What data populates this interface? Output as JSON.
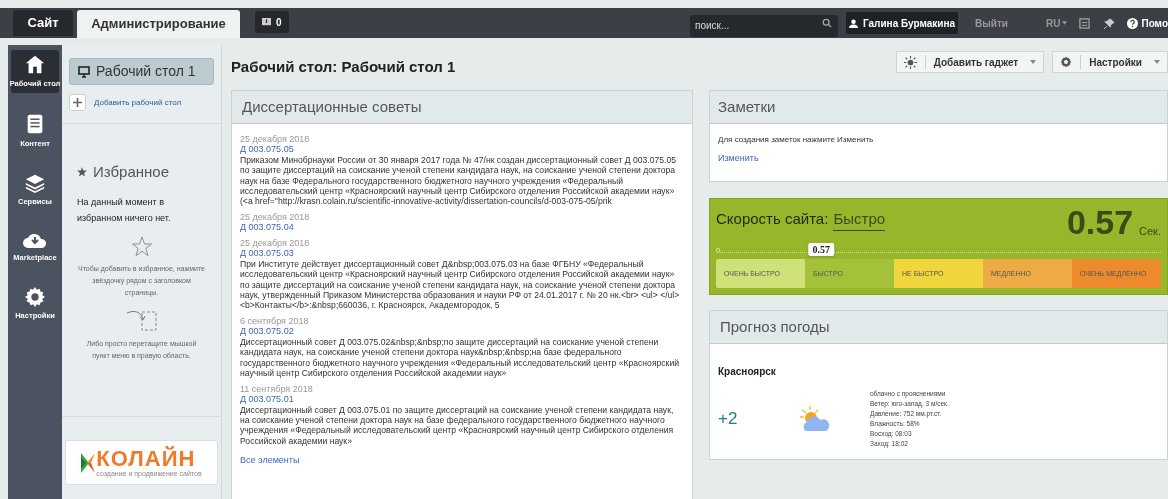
{
  "top_bar": {
    "tabs": [
      {
        "label": "Сайт",
        "selected": false
      },
      {
        "label": "Администрирование",
        "selected": true
      }
    ],
    "notifications": {
      "count": "0"
    },
    "search": {
      "placeholder": "поиск..."
    },
    "user": "Галина Бурмакина",
    "logout": "Выйти",
    "language": "RU",
    "help": "Помо"
  },
  "sidebar": {
    "items": [
      {
        "label": "Рабочий стол",
        "selected": true
      },
      {
        "label": "Контент",
        "selected": false
      },
      {
        "label": "Сервисы",
        "selected": false
      },
      {
        "label": "Marketplace",
        "selected": false
      },
      {
        "label": "Настройки",
        "selected": false
      }
    ]
  },
  "desktops_panel": {
    "desktops": [
      {
        "label": "Рабочий стол 1",
        "selected": true
      }
    ],
    "add_desktop": "Добавить рабочий стол",
    "favorites": {
      "title": "Избранное",
      "empty_text": "На данный момент в избранном ничего нет.",
      "hint_star": "Чтобы добавить в избранное, нажмите звёздочку рядом с заголовком страницы.",
      "hint_drag": "Либо просто перетащите мышкой пункт меню в правую область."
    },
    "logo": {
      "name": "КОЛАЙН",
      "tagline": "создание и продвижение сайтов"
    }
  },
  "page": {
    "title": "Рабочий стол: Рабочий стол 1",
    "buttons": [
      {
        "label": "Добавить гаджет"
      },
      {
        "label": "Настройки"
      }
    ]
  },
  "dissertation_councils": {
    "title": "Диссертационные советы",
    "items": [
      {
        "date": "25 декабря 2018",
        "code": "Д 003.075.05",
        "text": "Приказом Минобрнауки России от 30 января 2017 года № 47/нк создан диссертационный совет Д 003.075.05 по защите диссертаций на соискание ученой степени кандидата наук, на соискание ученой степени доктора наук на базе Федерального государственного бюджетного научного учреждения «Федеральный исследовательский центр «Красноярский научный центр Сибирского отделения Российской академии наук» (<a href=\"http://krasn.colain.ru/scientific-innovative-activity/dissertation-councils/d-003-075-05/prik"
      },
      {
        "date": "25 декабря 2018",
        "code": "Д 003.075.04"
      },
      {
        "date": "25 декабря 2018",
        "code": "Д 003.075.03",
        "text": "При Институте действует диссертационный совет Д&nbsp;003.075.03 на базе ФГБНУ «Федеральный исследовательский центр «Красноярский научный центр Сибирского отделения Российской академии наук» по защите диссертаций на соискание ученой степени кандидата наук, на соискание ученой степени доктора наук, утвержденный Приказом Министерства образования и науки РФ от 24.01.2017 г. № 20 нк.<br> <ul> </ul> <b>Контакты</b>:&nbsp;660036, г. Красноярск, Академгородок, 5"
      },
      {
        "date": "6 сентября 2018",
        "code": "Д 003.075.02",
        "text": "Диссертационный совет Д 003.075.02&nbsp;&nbsp;по защите диссертаций на соискание ученой степени кандидата наук, на соискание ученой степени доктора наук&nbsp;&nbsp;на базе федерального государственного бюджетного научного учреждения «Федеральный исследовательский центр «Красноярский научный центр Сибирского отделения Российской академии наук»"
      },
      {
        "date": "11 сентября 2018",
        "code": "Д 003.075.01",
        "text": "Диссертационный совет Д 003.075.01 по защите диссертаций на соискание ученой степени кандидата наук, на соискание ученой степени доктора наук на базе федерального государственного бюджетного научного учреждения «Федеральный исследовательский центр «Красноярский научный центр Сибирского отделения Российской академии наук»"
      }
    ],
    "all_link": "Все элементы"
  },
  "notes": {
    "title": "Заметки",
    "text": "Для создания заметок нажмите Изменить",
    "edit_link": "Изменить"
  },
  "site_speed": {
    "label": "Скорость сайта:",
    "rating": "Быстро",
    "value": "0.57",
    "unit": "Сек.",
    "scale_start": "0",
    "marker": {
      "label": "0.57",
      "level": 0.23
    },
    "segments": [
      {
        "label": "ОЧЕНЬ БЫСТРО",
        "color": "#cfe27a"
      },
      {
        "label": "БЫСТРО",
        "color": "#a3c23a"
      },
      {
        "label": "НЕ БЫСТРО",
        "color": "#f0d53c"
      },
      {
        "label": "МЕДЛЕННО",
        "color": "#eeaa44"
      },
      {
        "label": "ОЧЕНЬ МЕДЛЕННО",
        "color": "#ec8a2c"
      }
    ]
  },
  "weather": {
    "title": "Прогноз погоды",
    "city": "Красноярск",
    "temperature": "+2",
    "details": [
      "облачно с прояснениями",
      "Ветер: юго-запад, 3 м/сек.",
      "Давление: 752 мм.рт.ст.",
      "Влажность: 58%",
      "Восход: 08:03",
      "Заход: 18:02"
    ]
  }
}
